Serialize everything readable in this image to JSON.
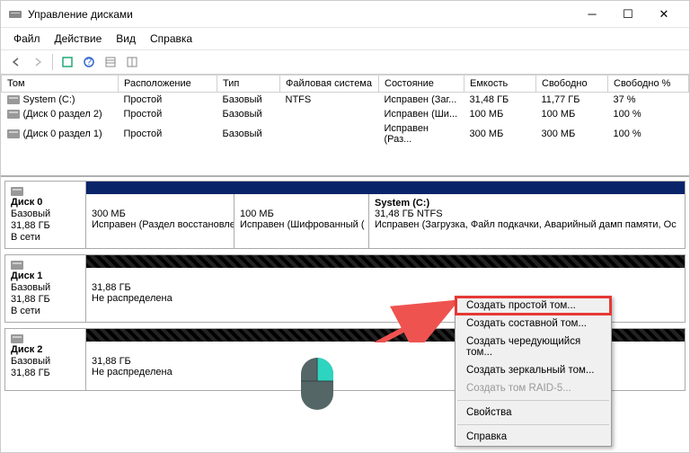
{
  "window": {
    "title": "Управление дисками"
  },
  "menu": {
    "file": "Файл",
    "action": "Действие",
    "view": "Вид",
    "help": "Справка"
  },
  "table": {
    "headers": [
      "Том",
      "Расположение",
      "Тип",
      "Файловая система",
      "Состояние",
      "Емкость",
      "Свободно",
      "Свободно %"
    ],
    "rows": [
      {
        "name": "System (C:)",
        "layout": "Простой",
        "type": "Базовый",
        "fs": "NTFS",
        "status": "Исправен (Заг...",
        "cap": "31,48 ГБ",
        "free": "11,77 ГБ",
        "pct": "37 %"
      },
      {
        "name": "(Диск 0 раздел 2)",
        "layout": "Простой",
        "type": "Базовый",
        "fs": "",
        "status": "Исправен (Ши...",
        "cap": "100 МБ",
        "free": "100 МБ",
        "pct": "100 %"
      },
      {
        "name": "(Диск 0 раздел 1)",
        "layout": "Простой",
        "type": "Базовый",
        "fs": "",
        "status": "Исправен (Раз...",
        "cap": "300 МБ",
        "free": "300 МБ",
        "pct": "100 %"
      }
    ]
  },
  "disk0": {
    "name": "Диск 0",
    "type": "Базовый",
    "size": "31,88 ГБ",
    "status": "В сети",
    "part0": {
      "size": "300 МБ",
      "status": "Исправен (Раздел восстановления"
    },
    "part1": {
      "size": "100 МБ",
      "status": "Исправен (Шифрованный ("
    },
    "part2": {
      "name": "System  (C:)",
      "desc": "31,48 ГБ NTFS",
      "status": "Исправен (Загрузка, Файл подкачки, Аварийный дамп памяти, Ос"
    }
  },
  "disk1": {
    "name": "Диск 1",
    "type": "Базовый",
    "size": "31,88 ГБ",
    "status": "В сети",
    "part_size": "31,88 ГБ",
    "part_status": "Не распределена"
  },
  "disk2": {
    "name": "Диск 2",
    "type": "Базовый",
    "size": "31,88 ГБ",
    "part_size": "31,88 ГБ",
    "part_status": "Не распределена"
  },
  "ctx": {
    "simple": "Создать простой том...",
    "spanned": "Создать составной том...",
    "striped": "Создать чередующийся том...",
    "mirrored": "Создать зеркальный том...",
    "raid5": "Создать том RAID-5...",
    "props": "Свойства",
    "help": "Справка"
  }
}
